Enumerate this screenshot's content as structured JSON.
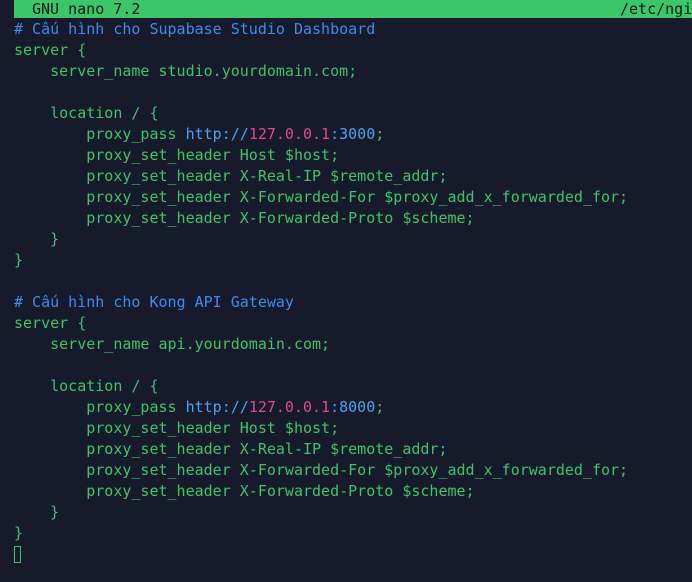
{
  "titlebar": {
    "app": "GNU nano 7.2",
    "path": "/etc/ngin"
  },
  "colors": {
    "background": "#171a2a",
    "titlebar_bg": "#3cc66a",
    "text_green": "#3cc66a",
    "comment_blue": "#3a8ef0",
    "url_blue": "#4aa3f2",
    "ip_pink": "#e0489a"
  },
  "blocks": [
    {
      "comment": "# Cấu hình cho Supabase Studio Dashboard",
      "server_open": "server {",
      "server_name": "    server_name studio.yourdomain.com;",
      "location_open": "    location / {",
      "proxy_pass_prefix": "        proxy_pass ",
      "proxy_pass_scheme": "http://",
      "proxy_pass_ip": "127.0.0.1",
      "proxy_pass_port": ":3000",
      "proxy_pass_suffix": ";",
      "headers": [
        "        proxy_set_header Host $host;",
        "        proxy_set_header X-Real-IP $remote_addr;",
        "        proxy_set_header X-Forwarded-For $proxy_add_x_forwarded_for;",
        "        proxy_set_header X-Forwarded-Proto $scheme;"
      ],
      "location_close": "    }",
      "server_close": "}"
    },
    {
      "comment": "# Cấu hình cho Kong API Gateway",
      "server_open": "server {",
      "server_name": "    server_name api.yourdomain.com;",
      "location_open": "    location / {",
      "proxy_pass_prefix": "        proxy_pass ",
      "proxy_pass_scheme": "http://",
      "proxy_pass_ip": "127.0.0.1",
      "proxy_pass_port": ":8000",
      "proxy_pass_suffix": ";",
      "headers": [
        "        proxy_set_header Host $host;",
        "        proxy_set_header X-Real-IP $remote_addr;",
        "        proxy_set_header X-Forwarded-For $proxy_add_x_forwarded_for;",
        "        proxy_set_header X-Forwarded-Proto $scheme;"
      ],
      "location_close": "    }",
      "server_close": "}"
    }
  ]
}
